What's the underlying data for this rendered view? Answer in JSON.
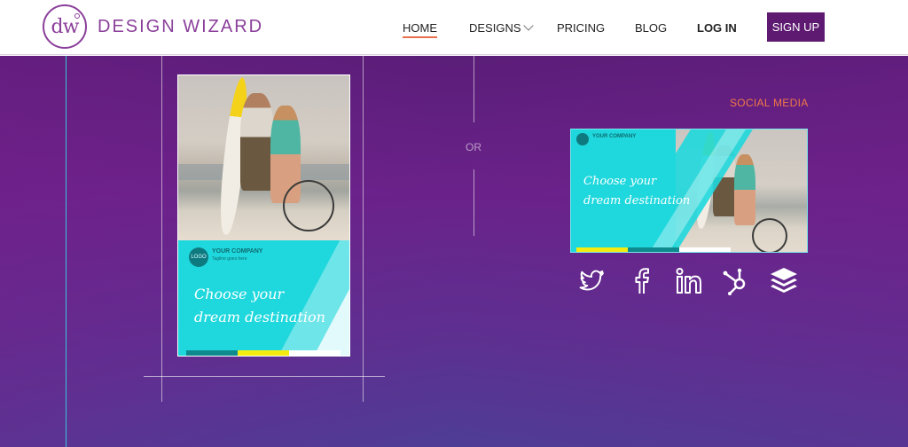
{
  "brand": {
    "monogram": "dw",
    "name": "DESIGN WIZARD"
  },
  "nav": {
    "home": "HOME",
    "designs": "DESIGNS",
    "pricing": "PRICING",
    "blog": "BLOG",
    "login": "LOG IN",
    "signup": "SIGN UP"
  },
  "hero": {
    "or_label": "OR",
    "social_label": "SOCIAL MEDIA"
  },
  "poster": {
    "logo_badge": "LOGO",
    "company": "YOUR COMPANY",
    "tagline": "Tagline goes here",
    "headline_line1": "Choose your",
    "headline_line2": "dream destination"
  },
  "banner": {
    "company": "YOUR COMPANY",
    "headline_line1": "Choose your",
    "headline_line2": "dream destination"
  },
  "social_icons": [
    "twitter-icon",
    "facebook-icon",
    "linkedin-icon",
    "hubspot-icon",
    "buffer-icon"
  ],
  "colors": {
    "brand_purple": "#8a3f9a",
    "signup_bg": "#5d1a70",
    "accent_orange": "#f07848",
    "template_cyan": "#1fd8dd",
    "strip_teal": "#0e8a8f",
    "strip_yellow": "#f4ec10",
    "strip_white": "#ffffff"
  }
}
